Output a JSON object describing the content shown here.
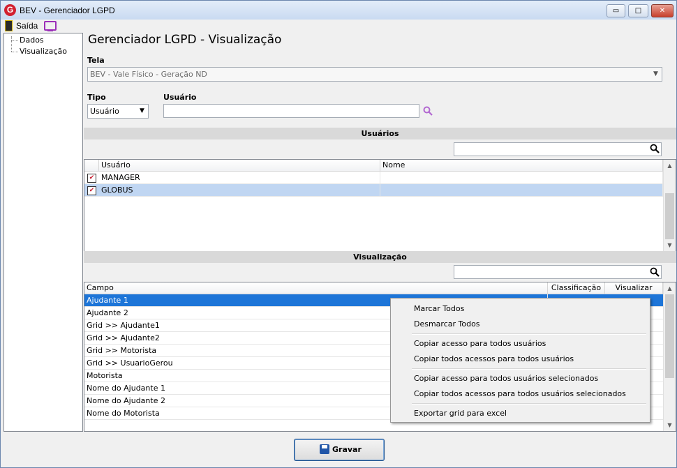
{
  "window": {
    "title": "BEV - Gerenciador LGPD",
    "app_icon": "G",
    "minimize_icon": "▭",
    "maximize_icon": "□",
    "close_icon": "✕"
  },
  "menu": {
    "exit_label": "Saída"
  },
  "tree": {
    "items": [
      "Dados",
      "Visualização"
    ]
  },
  "page": {
    "title": "Gerenciador LGPD - Visualização"
  },
  "tela": {
    "label": "Tela",
    "value": "BEV - Vale Físico - Geração ND"
  },
  "tipo": {
    "label": "Tipo",
    "value": "Usuário"
  },
  "usuario": {
    "label": "Usuário",
    "value": ""
  },
  "usuarios_section": {
    "title": "Usuários",
    "search_value": "",
    "columns": [
      "Usuário",
      "Nome"
    ],
    "rows": [
      {
        "checked": true,
        "usuario": "MANAGER",
        "nome": ""
      },
      {
        "checked": true,
        "usuario": "GLOBUS",
        "nome": ""
      }
    ]
  },
  "visualizacao_section": {
    "title": "Visualização",
    "search_value": "",
    "columns": [
      "Campo",
      "Classificação",
      "Visualizar"
    ],
    "rows": [
      {
        "campo": "Ajudante 1"
      },
      {
        "campo": "Ajudante 2"
      },
      {
        "campo": "Grid >> Ajudante1"
      },
      {
        "campo": "Grid >> Ajudante2"
      },
      {
        "campo": "Grid >> Motorista"
      },
      {
        "campo": "Grid >> UsuarioGerou"
      },
      {
        "campo": "Motorista"
      },
      {
        "campo": "Nome do Ajudante 1"
      },
      {
        "campo": "Nome do Ajudante 2"
      },
      {
        "campo": "Nome do Motorista"
      }
    ]
  },
  "context_menu": {
    "items": [
      "Marcar Todos",
      "Desmarcar Todos",
      "Copiar acesso para todos usuários",
      "Copiar todos acessos para todos usuários",
      "Copiar acesso para todos usuários selecionados",
      "Copiar todos acessos para todos usuários selecionados",
      "Exportar grid para excel"
    ]
  },
  "footer": {
    "save_label": "Gravar"
  },
  "colors": {
    "accent": "#1d75d8",
    "selected_light": "#c0d6f2",
    "icon_purple": "#9b2fb8",
    "brand_red": "#d22030"
  }
}
